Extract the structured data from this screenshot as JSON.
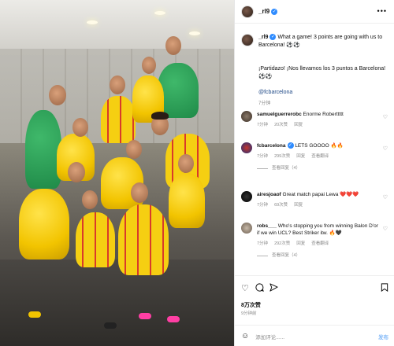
{
  "post": {
    "username": "_rl9",
    "caption_en": "What a game! 3 points are going with us to Barcelona! ⚽⚽",
    "caption_es": "¡Partidazo! ¡Nos llevamos los 3 puntos a Barcelona! ⚽⚽",
    "tag": "@fcbarcelona",
    "caption_time": "7分钟",
    "likes": "8万次赞",
    "date": "9分钟前"
  },
  "comments": [
    {
      "user": "samuelguerrerobc",
      "text": "Enorme Roberttttt",
      "time": "7分钟",
      "likes": "20次赞",
      "reply": "回复"
    },
    {
      "user": "fcbarcelona",
      "text": "LETS GOOOO 🔥🔥",
      "time": "7分钟",
      "likes": "299次赞",
      "reply": "回复",
      "translate": "查看翻译",
      "view_replies": "查看回复（4）"
    },
    {
      "user": "airesjoaof",
      "text": "Great match papai Lewa ❤️❤️❤️",
      "time": "7分钟",
      "likes": "69次赞",
      "reply": "回复"
    },
    {
      "user": "robs___",
      "text": "Who's stopping you from winning Balon D'or if we win UCL? Best Striker itw. 🔥🖤",
      "time": "7分钟",
      "likes": "292次赞",
      "reply": "回复",
      "translate": "查看翻译",
      "view_replies": "查看回复（4）"
    }
  ],
  "comment_box": {
    "placeholder": "添加评论......",
    "post_label": "发布"
  },
  "icons": {
    "heart": "heart-icon",
    "comment": "comment-icon",
    "share": "share-icon",
    "save": "bookmark-icon",
    "more": "more-icon",
    "emoji": "emoji-icon"
  },
  "colors": {
    "accent": "#2f8cff",
    "kit_yellow": "#f2c400",
    "boot_pink": "#ff3fa4"
  }
}
